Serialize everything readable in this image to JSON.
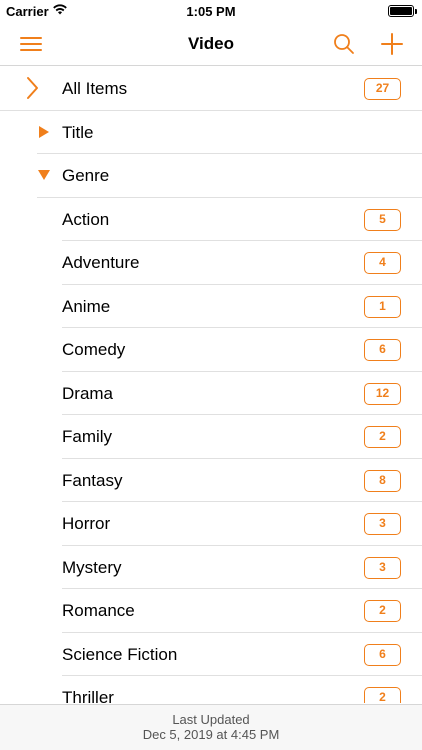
{
  "status": {
    "carrier": "Carrier",
    "time": "1:05 PM"
  },
  "nav": {
    "title": "Video"
  },
  "colors": {
    "accent": "#f07f1b"
  },
  "icons": {
    "menu": "hamburger-icon",
    "search": "search-icon",
    "add": "plus-icon"
  },
  "list": {
    "all_items": {
      "label": "All Items",
      "count": "27"
    },
    "title_group": {
      "label": "Title"
    },
    "genre_group": {
      "label": "Genre"
    },
    "genres": [
      {
        "label": "Action",
        "count": "5"
      },
      {
        "label": "Adventure",
        "count": "4"
      },
      {
        "label": "Anime",
        "count": "1"
      },
      {
        "label": "Comedy",
        "count": "6"
      },
      {
        "label": "Drama",
        "count": "12"
      },
      {
        "label": "Family",
        "count": "2"
      },
      {
        "label": "Fantasy",
        "count": "8"
      },
      {
        "label": "Horror",
        "count": "3"
      },
      {
        "label": "Mystery",
        "count": "3"
      },
      {
        "label": "Romance",
        "count": "2"
      },
      {
        "label": "Science Fiction",
        "count": "6"
      },
      {
        "label": "Thriller",
        "count": "2"
      }
    ]
  },
  "footer": {
    "line1": "Last Updated",
    "line2": "Dec 5, 2019 at 4:45 PM"
  }
}
